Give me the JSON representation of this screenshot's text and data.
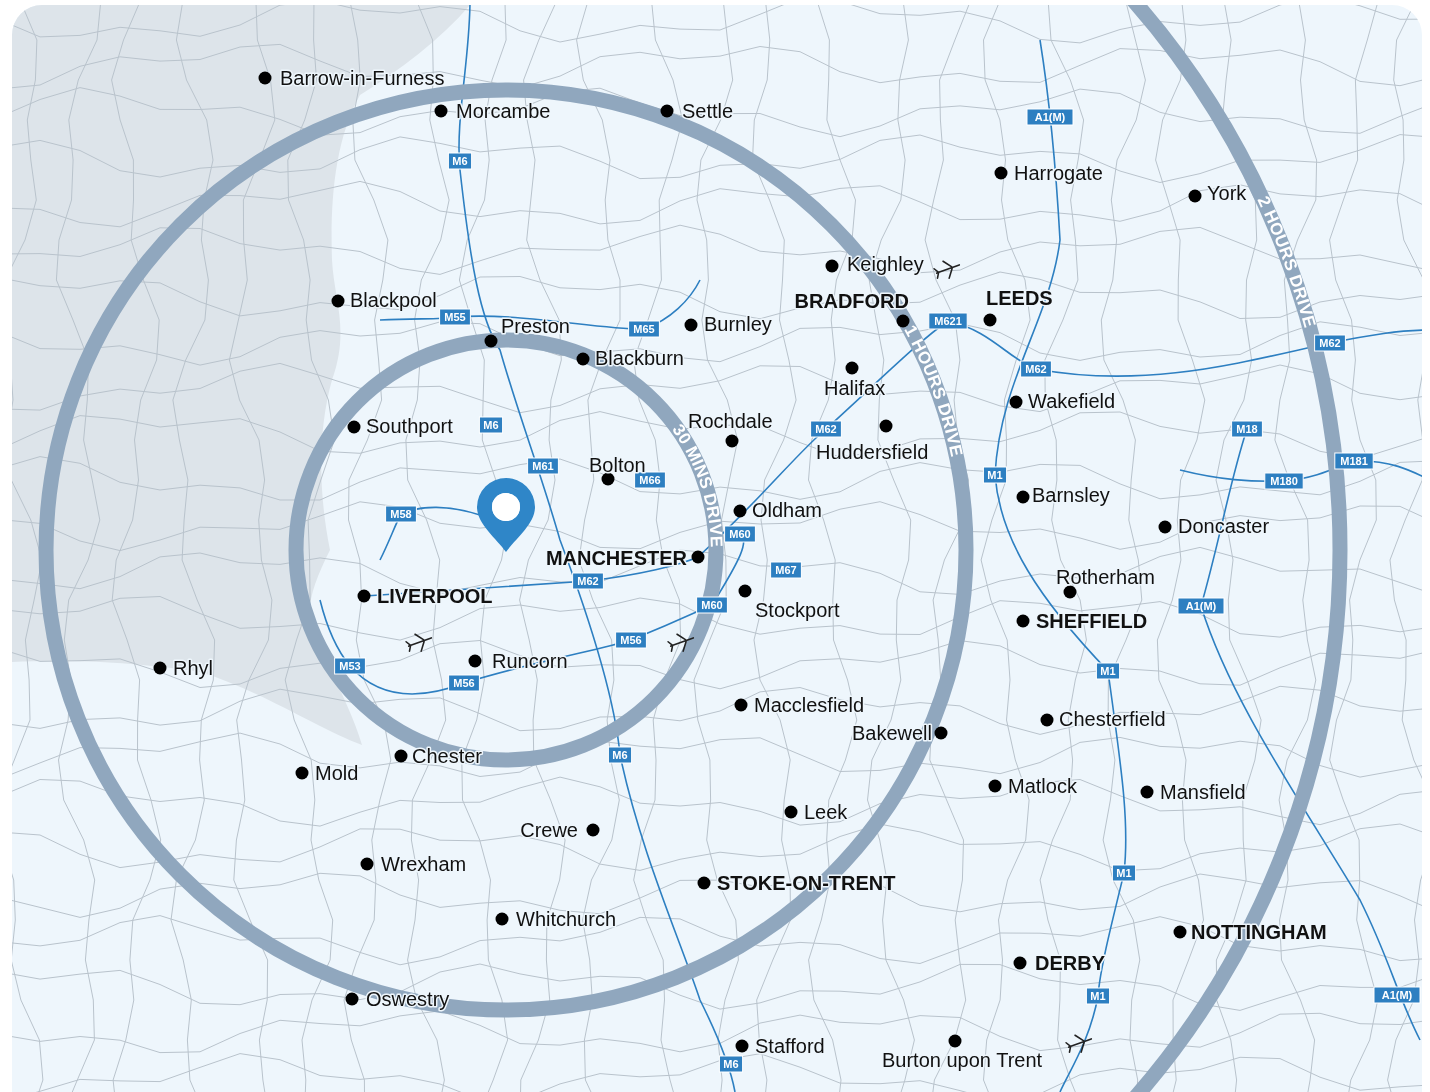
{
  "map": {
    "drive_rings": [
      {
        "label": "30 MINS DRIVE"
      },
      {
        "label": "1 HOURS DRIVE"
      },
      {
        "label": "2 HOURS DRIVE"
      }
    ],
    "cities": [
      {
        "name": "Barrow-in-Furness",
        "major": false
      },
      {
        "name": "Morcambe",
        "major": false
      },
      {
        "name": "Settle",
        "major": false
      },
      {
        "name": "Harrogate",
        "major": false
      },
      {
        "name": "York",
        "major": false
      },
      {
        "name": "Keighley",
        "major": false
      },
      {
        "name": "Blackpool",
        "major": false
      },
      {
        "name": "BRADFORD",
        "major": true
      },
      {
        "name": "LEEDS",
        "major": true
      },
      {
        "name": "Preston",
        "major": false
      },
      {
        "name": "Burnley",
        "major": false
      },
      {
        "name": "Blackburn",
        "major": false
      },
      {
        "name": "Halifax",
        "major": false
      },
      {
        "name": "Wakefield",
        "major": false
      },
      {
        "name": "Southport",
        "major": false
      },
      {
        "name": "Rochdale",
        "major": false
      },
      {
        "name": "Huddersfield",
        "major": false
      },
      {
        "name": "Bolton",
        "major": false
      },
      {
        "name": "Barnsley",
        "major": false
      },
      {
        "name": "Oldham",
        "major": false
      },
      {
        "name": "Doncaster",
        "major": false
      },
      {
        "name": "MANCHESTER",
        "major": true
      },
      {
        "name": "Rotherham",
        "major": false
      },
      {
        "name": "LIVERPOOL",
        "major": true
      },
      {
        "name": "Stockport",
        "major": false
      },
      {
        "name": "SHEFFIELD",
        "major": true
      },
      {
        "name": "Runcorn",
        "major": false
      },
      {
        "name": "Rhyl",
        "major": false
      },
      {
        "name": "Macclesfield",
        "major": false
      },
      {
        "name": "Chesterfield",
        "major": false
      },
      {
        "name": "Bakewell",
        "major": false
      },
      {
        "name": "Chester",
        "major": false
      },
      {
        "name": "Mold",
        "major": false
      },
      {
        "name": "Matlock",
        "major": false
      },
      {
        "name": "Mansfield",
        "major": false
      },
      {
        "name": "Leek",
        "major": false
      },
      {
        "name": "Crewe",
        "major": false
      },
      {
        "name": "Wrexham",
        "major": false
      },
      {
        "name": "STOKE-ON-TRENT",
        "major": true
      },
      {
        "name": "Whitchurch",
        "major": false
      },
      {
        "name": "NOTTINGHAM",
        "major": true
      },
      {
        "name": "DERBY",
        "major": true
      },
      {
        "name": "Oswestry",
        "major": false
      },
      {
        "name": "Stafford",
        "major": false
      },
      {
        "name": "Burton upon Trent",
        "major": false
      }
    ],
    "motorways": [
      {
        "label": "A1(M)"
      },
      {
        "label": "M6"
      },
      {
        "label": "M621"
      },
      {
        "label": "M55"
      },
      {
        "label": "M65"
      },
      {
        "label": "M62"
      },
      {
        "label": "M62"
      },
      {
        "label": "M6"
      },
      {
        "label": "M62"
      },
      {
        "label": "M18"
      },
      {
        "label": "M61"
      },
      {
        "label": "M66"
      },
      {
        "label": "M1"
      },
      {
        "label": "M180"
      },
      {
        "label": "M181"
      },
      {
        "label": "M58"
      },
      {
        "label": "M60"
      },
      {
        "label": "M67"
      },
      {
        "label": "M62"
      },
      {
        "label": "M60"
      },
      {
        "label": "A1(M)"
      },
      {
        "label": "M56"
      },
      {
        "label": "M53"
      },
      {
        "label": "M1"
      },
      {
        "label": "M56"
      },
      {
        "label": "M6"
      },
      {
        "label": "M1"
      },
      {
        "label": "M1"
      },
      {
        "label": "A1(M)"
      },
      {
        "label": "M6"
      }
    ]
  }
}
